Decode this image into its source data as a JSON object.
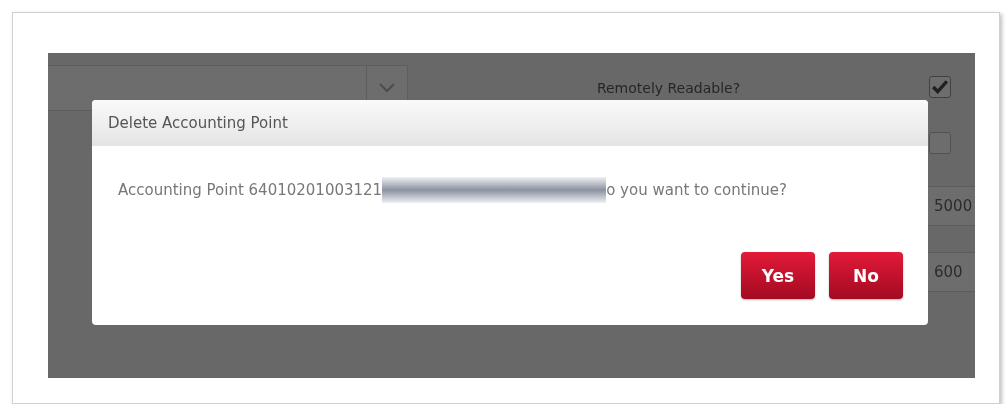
{
  "background_form": {
    "remotely_readable": {
      "label": "Remotely Readable?",
      "checked": true
    },
    "second_checkbox": {
      "checked": false
    },
    "fields": [
      {
        "value": "5000"
      },
      {
        "value": "600"
      }
    ]
  },
  "dialog": {
    "title": "Delete Accounting Point",
    "message_before": "Accounting Point 64010201003121",
    "message_after": "o you want to continue?",
    "buttons": [
      {
        "label": "Yes"
      },
      {
        "label": "No"
      }
    ]
  }
}
